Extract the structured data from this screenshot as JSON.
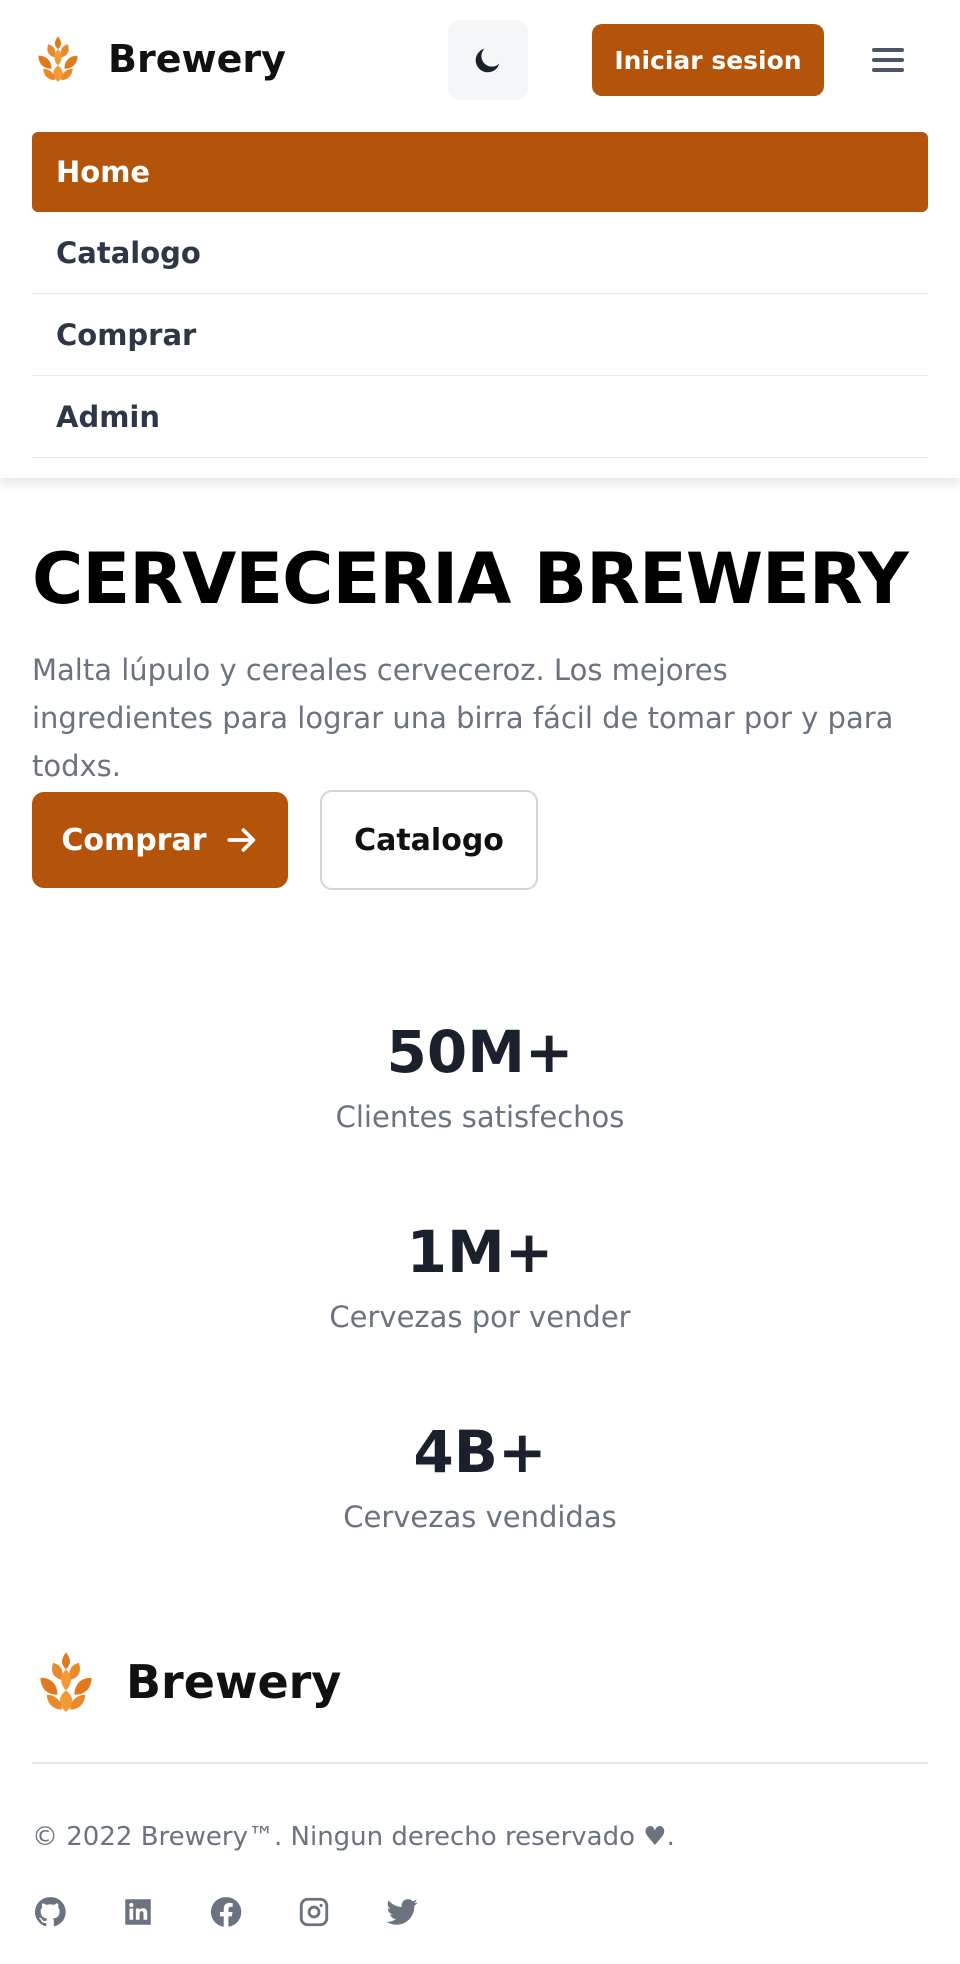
{
  "header": {
    "brand": "Brewery",
    "theme_toggle_icon": "moon-icon",
    "login_label": "Iniciar sesion",
    "menu_icon": "hamburger-menu-icon"
  },
  "nav": {
    "items": [
      {
        "label": "Home",
        "active": true
      },
      {
        "label": "Catalogo",
        "active": false
      },
      {
        "label": "Comprar",
        "active": false
      },
      {
        "label": "Admin",
        "active": false
      }
    ]
  },
  "hero": {
    "title": "CERVECERIA BREWERY",
    "subtitle": "Malta lúpulo y cereales cerveceroz. Los mejores ingredientes para lograr una birra fácil de tomar por y para todxs.",
    "primary_button": "Comprar",
    "secondary_button": "Catalogo"
  },
  "stats": [
    {
      "value": "50M+",
      "label": "Clientes satisfechos"
    },
    {
      "value": "1M+",
      "label": "Cervezas por vender"
    },
    {
      "value": "4B+",
      "label": "Cervezas vendidas"
    }
  ],
  "footer": {
    "brand": "Brewery",
    "copyright": "© 2022 Brewery™. Ningun derecho reservado ♥.",
    "socials": [
      "github-icon",
      "linkedin-icon",
      "facebook-icon",
      "instagram-icon",
      "twitter-icon"
    ]
  },
  "colors": {
    "accent": "#b4540a",
    "text_muted": "#6b7280",
    "text_dark": "#111827"
  }
}
